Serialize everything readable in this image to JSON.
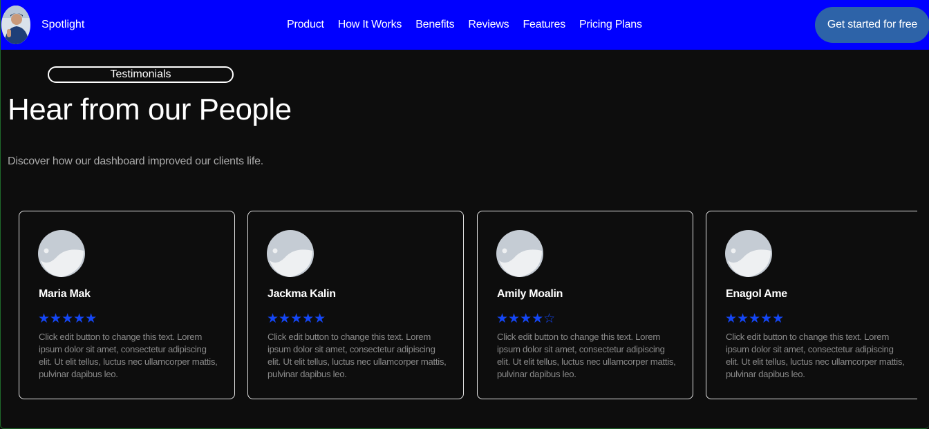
{
  "header": {
    "brand": "Spotlight",
    "nav": [
      "Product",
      "How It Works",
      "Benefits",
      "Reviews",
      "Features",
      "Pricing Plans"
    ],
    "cta_label": "Get started for free"
  },
  "hero": {
    "badge": "Testimonials",
    "title": "Hear from our People",
    "subtitle": "Discover how our dashboard improved our clients life."
  },
  "testimonials": [
    {
      "name": "Maria Mak",
      "rating": 5,
      "stars": "★★★★★",
      "text": "Click edit button to change this text. Lorem ipsum dolor sit amet, consectetur adipiscing elit. Ut elit tellus, luctus nec ullamcorper mattis, pulvinar dapibus leo."
    },
    {
      "name": "Jackma Kalin",
      "rating": 5,
      "stars": "★★★★★",
      "text": "Click edit button to change this text. Lorem ipsum dolor sit amet, consectetur adipiscing elit. Ut elit tellus, luctus nec ullamcorper mattis, pulvinar dapibus leo."
    },
    {
      "name": "Amily Moalin",
      "rating": 4,
      "stars": "★★★★☆",
      "text": "Click edit button to change this text. Lorem ipsum dolor sit amet, consectetur adipiscing elit. Ut elit tellus, luctus nec ullamcorper mattis, pulvinar dapibus leo."
    },
    {
      "name": "Enagol Ame",
      "rating": 5,
      "stars": "★★★★★",
      "text": "Click edit button to change this text. Lorem ipsum dolor sit amet, consectetur adipiscing elit. Ut elit tellus, luctus nec ullamcorper mattis, pulvinar dapibus leo."
    }
  ],
  "colors": {
    "header_bg": "#0000ff",
    "cta_bg": "#2d63a8",
    "page_bg": "#0d0d0d",
    "star": "#1446f5"
  },
  "icons": [
    "profile-photo",
    "image-placeholder-icon",
    "star-icon"
  ]
}
